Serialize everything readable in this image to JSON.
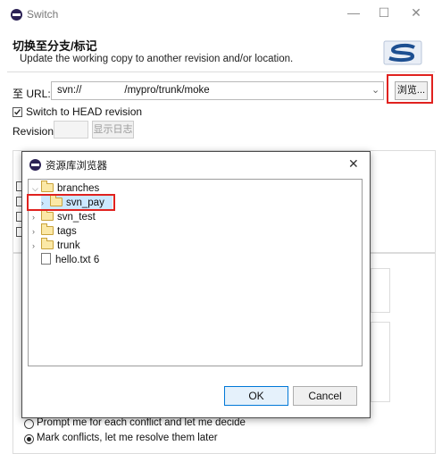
{
  "window": {
    "title": "Switch",
    "minimize_label": "—",
    "maximize_label": "☐",
    "close_label": "✕"
  },
  "header": {
    "title": "切换至分支/标记",
    "description": "Update the working copy to another revision and/or location."
  },
  "url": {
    "label": "至 URL:",
    "value": "svn://               /mypro/trunk/moke",
    "browse_label": "浏览..."
  },
  "switch_head": {
    "label": "Switch to HEAD revision",
    "checked": true
  },
  "revision": {
    "label": "Revision:",
    "value": "",
    "show_log_label": "显示日志"
  },
  "conflict_options": [
    {
      "label": "Prompt me for each conflict and let me decide",
      "selected": false
    },
    {
      "label": "Mark conflicts, let me resolve them later",
      "selected": true
    }
  ],
  "repo_browser": {
    "title": "资源库浏览器",
    "close_label": "✕",
    "tree": [
      {
        "label": "branches",
        "type": "folder",
        "expanded": true,
        "depth": 0
      },
      {
        "label": "svn_pay",
        "type": "folder",
        "expanded": false,
        "depth": 1,
        "selected": true
      },
      {
        "label": "svn_test",
        "type": "folder",
        "expanded": false,
        "depth": 0
      },
      {
        "label": "tags",
        "type": "folder",
        "expanded": false,
        "depth": 0
      },
      {
        "label": "trunk",
        "type": "folder",
        "expanded": false,
        "depth": 0
      },
      {
        "label": "hello.txt 6",
        "type": "file",
        "depth": 0
      }
    ],
    "ok_label": "OK",
    "cancel_label": "Cancel"
  },
  "colors": {
    "highlight_red": "#e0221f",
    "ok_border": "#0078d7",
    "selection_bg": "#cce8ff"
  }
}
